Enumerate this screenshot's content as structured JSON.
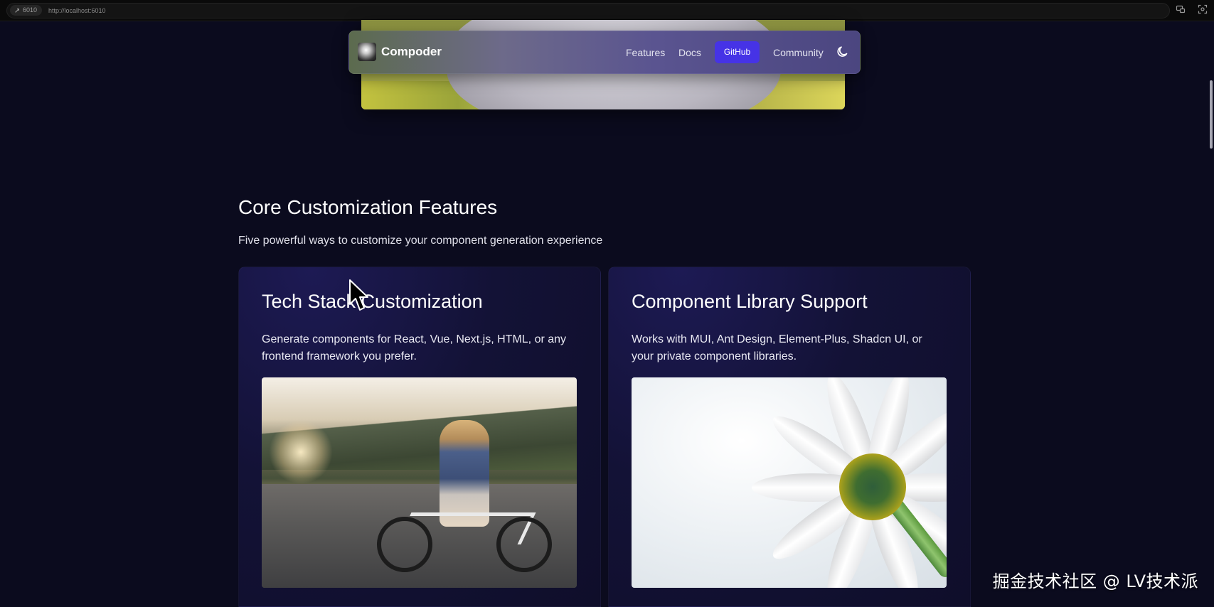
{
  "browser": {
    "port_badge": "6010",
    "url": "http://localhost:6010"
  },
  "navbar": {
    "brand": "Compoder",
    "links": {
      "features": "Features",
      "docs": "Docs",
      "github": "GitHub",
      "community": "Community"
    }
  },
  "section": {
    "title": "Core Customization Features",
    "subtitle": "Five powerful ways to customize your component generation experience"
  },
  "cards": [
    {
      "title": "Tech Stack Customization",
      "description": "Generate components for React, Vue, Next.js, HTML, or any frontend framework you prefer."
    },
    {
      "title": "Component Library Support",
      "description": "Works with MUI, Ant Design, Element-Plus, Shadcn UI, or your private component libraries."
    }
  ],
  "watermark": "掘金技术社区 @ LV技术派",
  "colors": {
    "page_bg": "#0b0b1e",
    "accent": "#4633e6",
    "card_bg": "#131236"
  }
}
